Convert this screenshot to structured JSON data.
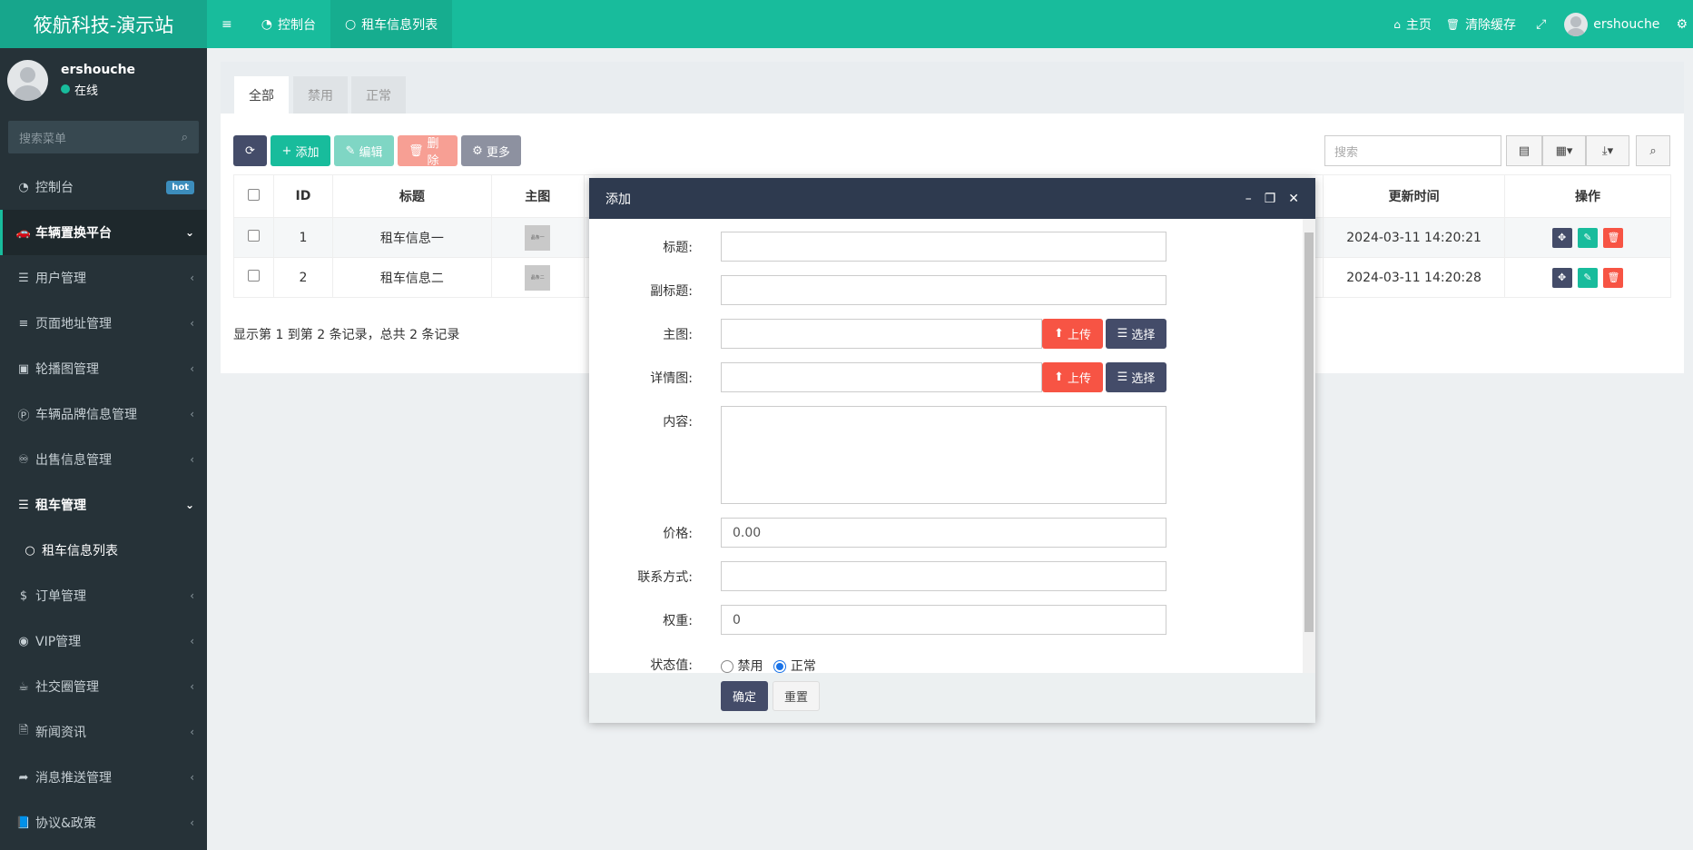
{
  "app": {
    "title": "筱航科技-演示站"
  },
  "topbar": {
    "menu_toggle_icon": "menu-icon",
    "tabs": [
      {
        "label": "控制台",
        "icon": "dashboard-icon"
      },
      {
        "label": "租车信息列表",
        "icon": "circle-icon"
      }
    ],
    "home_label": "主页",
    "clear_cache_label": "清除缓存",
    "username": "ershouche"
  },
  "sidebar": {
    "username": "ershouche",
    "status": "在线",
    "search_placeholder": "搜索菜单",
    "items": [
      {
        "label": "控制台",
        "badge": "hot"
      },
      {
        "label": "车辆置换平台"
      },
      {
        "label": "用户管理"
      },
      {
        "label": "页面地址管理"
      },
      {
        "label": "轮播图管理"
      },
      {
        "label": "车辆品牌信息管理"
      },
      {
        "label": "出售信息管理"
      },
      {
        "label": "租车管理"
      },
      {
        "label": "租车信息列表"
      },
      {
        "label": "订单管理"
      },
      {
        "label": "VIP管理"
      },
      {
        "label": "社交圈管理"
      },
      {
        "label": "新闻资讯"
      },
      {
        "label": "消息推送管理"
      },
      {
        "label": "协议&政策"
      }
    ]
  },
  "main": {
    "tabs": [
      "全部",
      "禁用",
      "正常"
    ],
    "toolbar": {
      "add": "添加",
      "edit": "编辑",
      "delete": "删除",
      "more": "更多"
    },
    "search_placeholder": "搜索",
    "table": {
      "columns": [
        "ID",
        "标题",
        "主图",
        "更新时间",
        "操作"
      ],
      "rows": [
        {
          "id": "1",
          "title": "租车信息一",
          "thumb": "晶条一",
          "updated": "2024-03-11 14:20:21"
        },
        {
          "id": "2",
          "title": "租车信息二",
          "thumb": "晶条二",
          "updated": "2024-03-11 14:20:28"
        }
      ]
    },
    "pager_text": "显示第 1 到第 2 条记录，总共 2 条记录"
  },
  "modal": {
    "title": "添加",
    "fields": {
      "title_label": "标题:",
      "subtitle_label": "副标题:",
      "main_image_label": "主图:",
      "detail_image_label": "详情图:",
      "content_label": "内容:",
      "price_label": "价格:",
      "price_value": "0.00",
      "contact_label": "联系方式:",
      "weight_label": "权重:",
      "weight_value": "0",
      "status_label": "状态值:",
      "status_options": [
        "禁用",
        "正常"
      ],
      "status_selected": "正常"
    },
    "upload_label": "上传",
    "choose_label": "选择",
    "confirm_label": "确定",
    "reset_label": "重置"
  },
  "colors": {
    "brand": "#18bc9c",
    "sidebar_bg": "#263238",
    "modal_header": "#2e3a4f",
    "danger": "#f75444",
    "navy": "#444c69"
  }
}
